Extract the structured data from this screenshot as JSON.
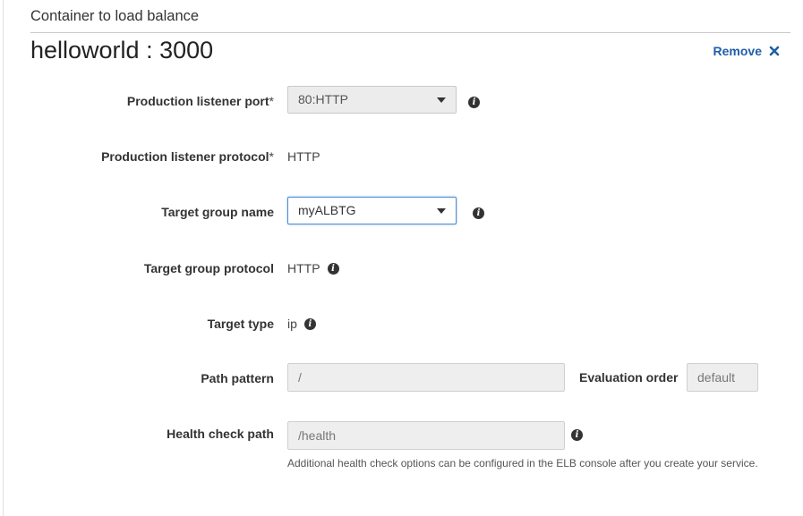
{
  "section": {
    "title": "Container to load balance"
  },
  "container": {
    "title": "helloworld : 3000",
    "remove_label": "Remove"
  },
  "fields": {
    "listener_port": {
      "label": "Production listener port",
      "required_mark": "*",
      "value": "80:HTTP",
      "info_icon": "info-icon"
    },
    "listener_protocol": {
      "label": "Production listener protocol",
      "required_mark": "*",
      "value": "HTTP"
    },
    "target_group_name": {
      "label": "Target group name",
      "value": "myALBTG",
      "info_icon": "info-icon"
    },
    "target_group_protocol": {
      "label": "Target group protocol",
      "value": "HTTP",
      "info_icon": "info-icon"
    },
    "target_type": {
      "label": "Target type",
      "value": "ip",
      "info_icon": "info-icon"
    },
    "path_pattern": {
      "label": "Path pattern",
      "value": "/"
    },
    "evaluation_order": {
      "label": "Evaluation order",
      "value": "default"
    },
    "health_check_path": {
      "label": "Health check path",
      "value": "/health",
      "help": "Additional health check options can be configured in the ELB console after you create your service.",
      "info_icon": "info-icon"
    }
  },
  "colors": {
    "link": "#1f5fa7",
    "focus_border": "#4f8fd6",
    "disabled_bg": "#eeeeee"
  }
}
